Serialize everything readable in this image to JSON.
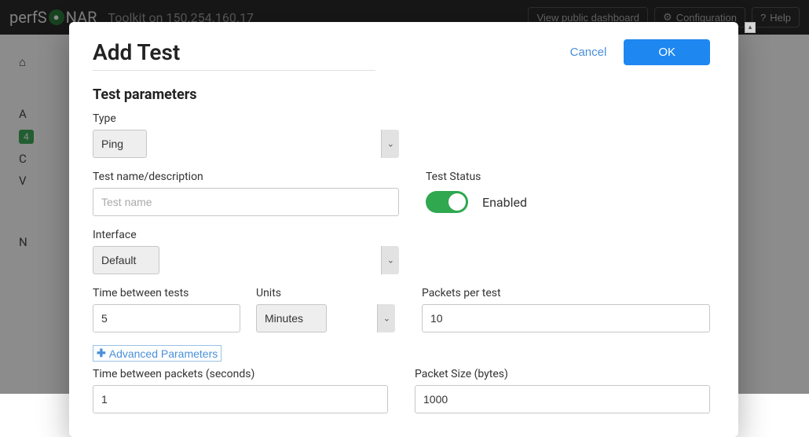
{
  "topbar": {
    "brand_pre": "perfS",
    "brand_post": "NAR",
    "subtitle": "Toolkit on 150.254.160.17",
    "view_dashboard": "View public dashboard",
    "configuration": "Configuration",
    "help": "Help"
  },
  "bg": {
    "a": "A",
    "badge": "4",
    "c": "C",
    "v": "V",
    "n": "N"
  },
  "modal": {
    "title": "Add Test",
    "cancel": "Cancel",
    "ok": "OK",
    "section_title": "Test parameters",
    "type_label": "Type",
    "type_value": "Ping",
    "name_label": "Test name/description",
    "name_placeholder": "Test name",
    "status_label": "Test Status",
    "status_value": "Enabled",
    "interface_label": "Interface",
    "interface_value": "Default",
    "time_between_label": "Time between tests",
    "time_between_value": "5",
    "units_label": "Units",
    "units_value": "Minutes",
    "packets_label": "Packets per test",
    "packets_value": "10",
    "advanced": "Advanced Parameters",
    "time_packets_label": "Time between packets (seconds)",
    "time_packets_value": "1",
    "packet_size_label": "Packet Size (bytes)",
    "packet_size_value": "1000"
  }
}
